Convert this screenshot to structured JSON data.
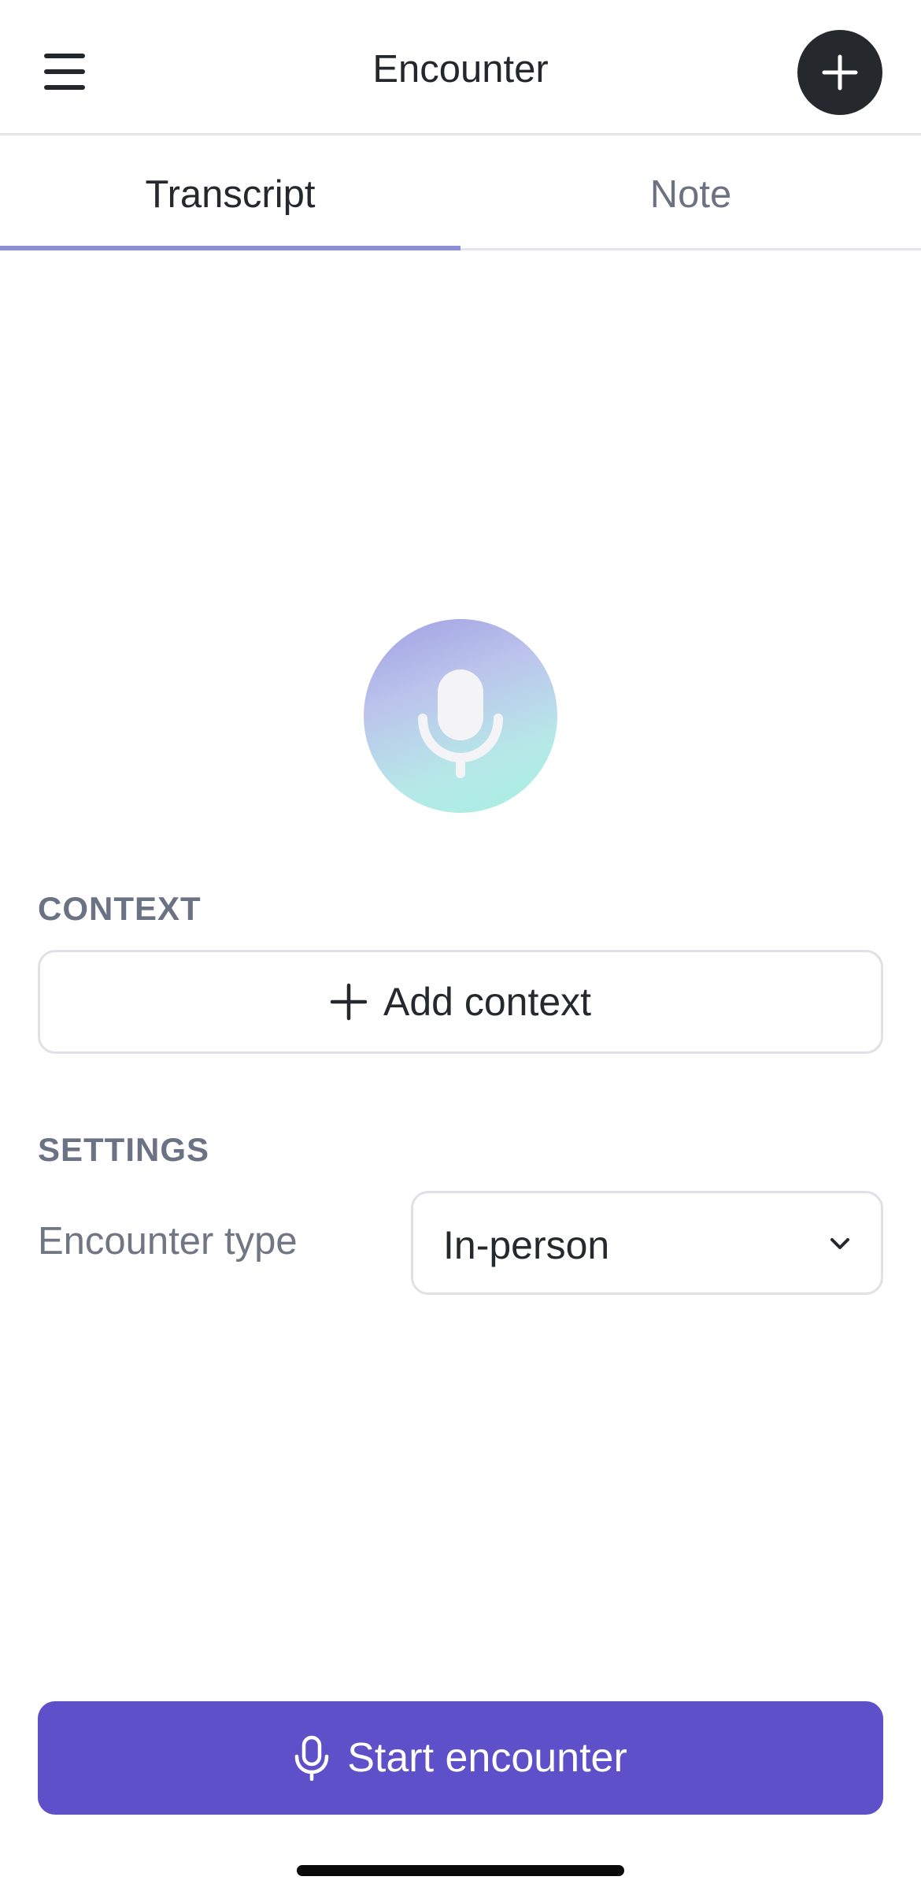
{
  "header": {
    "title": "Encounter",
    "menu_icon": "hamburger-menu-icon",
    "add_icon": "plus-icon"
  },
  "tabs": [
    {
      "label": "Transcript",
      "active": true
    },
    {
      "label": "Note",
      "active": false
    }
  ],
  "hero": {
    "icon": "microphone-icon"
  },
  "context": {
    "section_label": "CONTEXT",
    "add_button_label": "Add context"
  },
  "settings": {
    "section_label": "SETTINGS",
    "encounter_type_label": "Encounter type",
    "encounter_type_value": "In-person"
  },
  "footer": {
    "start_button_label": "Start encounter"
  },
  "colors": {
    "accent": "#5d50c8",
    "tab_underline": "#8e8ed6",
    "dark_button": "#25292d"
  }
}
